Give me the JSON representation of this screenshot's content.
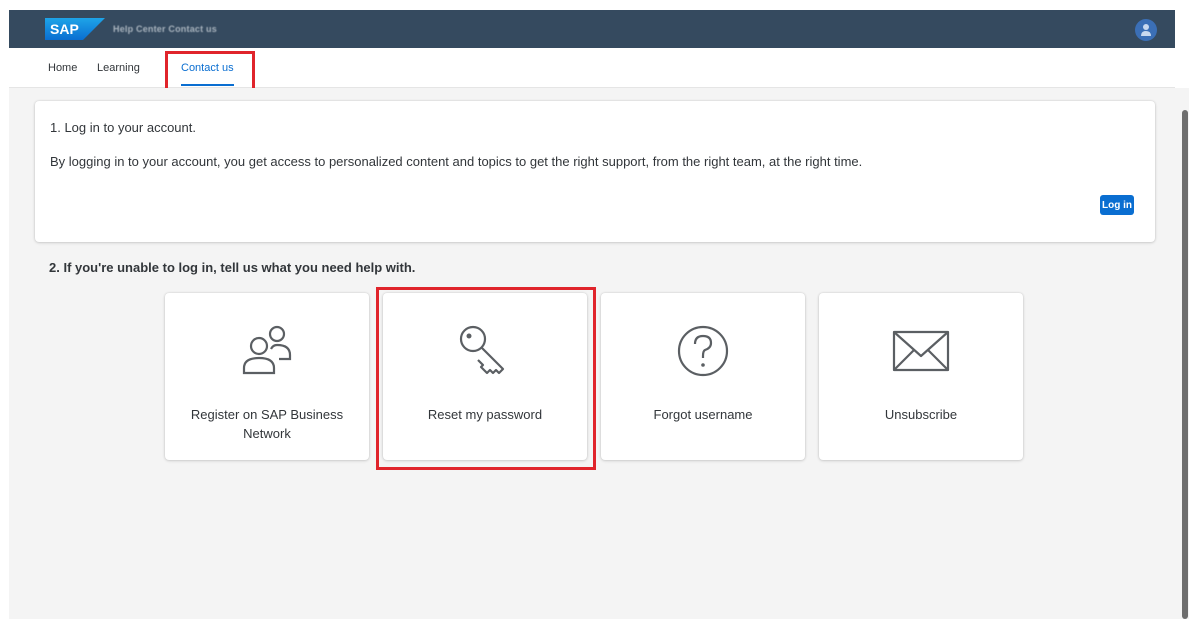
{
  "shell": {
    "logo_text": "SAP",
    "title": "Help Center Contact us",
    "brand_color": "#354a5f",
    "avatar_icon": "person-icon"
  },
  "tabs": [
    {
      "label": "Home",
      "active": false
    },
    {
      "label": "Learning",
      "active": false
    },
    {
      "label": "Contact us",
      "active": true
    }
  ],
  "login_section": {
    "heading": "1. Log in to your account.",
    "description": "By logging in to your account, you get access to personalized content and topics to get the right support, from the right team, at the right time.",
    "button_label": "Log in"
  },
  "help_section": {
    "heading": "2. If you're unable to log in, tell us what you need help with.",
    "tiles": [
      {
        "label": "Register on SAP Business Network",
        "icon": "users-icon"
      },
      {
        "label": "Reset my password",
        "icon": "key-icon"
      },
      {
        "label": "Forgot username",
        "icon": "question-circle-icon"
      },
      {
        "label": "Unsubscribe",
        "icon": "envelope-icon"
      }
    ]
  },
  "colors": {
    "accent": "#0a6ed1",
    "highlight": "#e0242b",
    "background": "#f4f4f4"
  }
}
